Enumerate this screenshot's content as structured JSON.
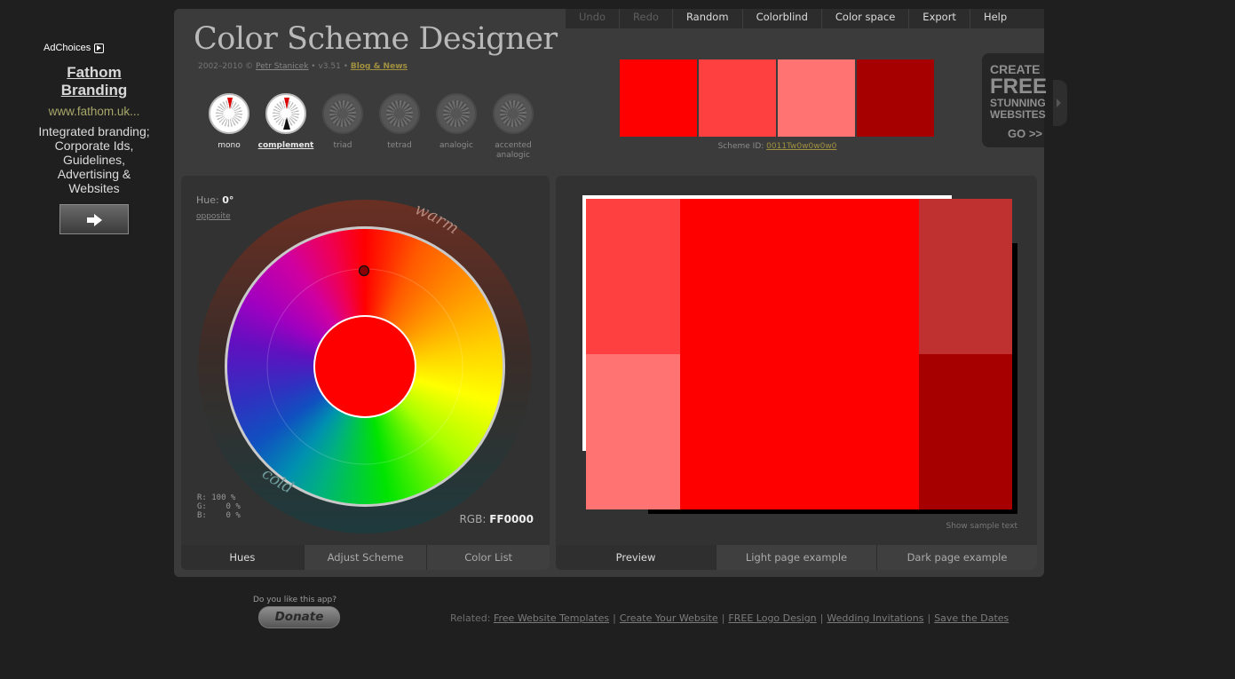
{
  "ad": {
    "adchoices": "AdChoices",
    "title": "Fathom Branding",
    "url": "www.fathom.uk...",
    "description": "Integrated branding; Corporate Ids, Guidelines, Advertising & Websites",
    "button_icon": "arrow-right-icon"
  },
  "header": {
    "title": "Color Scheme Designer",
    "credits_prefix": "2002–2010 © ",
    "author": "Petr Stanicek",
    "version": " • v3.51 • ",
    "blog": "Blog & News"
  },
  "menu": [
    {
      "label": "Undo",
      "enabled": false
    },
    {
      "label": "Redo",
      "enabled": false
    },
    {
      "label": "Random",
      "enabled": true
    },
    {
      "label": "Colorblind",
      "enabled": true
    },
    {
      "label": "Color space",
      "enabled": true
    },
    {
      "label": "Export",
      "enabled": true
    },
    {
      "label": "Help",
      "enabled": true
    }
  ],
  "modes": [
    {
      "label": "mono",
      "active": false,
      "available": true
    },
    {
      "label": "complement",
      "active": true,
      "available": true
    },
    {
      "label": "triad",
      "active": false,
      "available": false
    },
    {
      "label": "tetrad",
      "active": false,
      "available": false
    },
    {
      "label": "analogic",
      "active": false,
      "available": false
    },
    {
      "label": "accented analogic",
      "active": false,
      "available": false
    }
  ],
  "scheme": {
    "swatches": [
      "#FF0000",
      "#FF4040",
      "#FF7373",
      "#A60000"
    ],
    "id_label": "Scheme ID: ",
    "id_value": "0011Tw0w0w0w0"
  },
  "promo": {
    "line1": "CREATE",
    "line2": "FREE",
    "line3": "STUNNING",
    "line4": "WEBSITES",
    "cta": "GO >>"
  },
  "wheel": {
    "hue_label": "Hue: ",
    "hue_value": "0°",
    "opposite": "opposite",
    "warm": "warm",
    "cold": "cold",
    "selected_color": "#FF0000",
    "rgb_pct": "R: 100 %\nG:    0 %\nB:    0 %",
    "rgb_label": "RGB: ",
    "rgb_value": "FF0000",
    "tabs": [
      "Hues",
      "Adjust Scheme",
      "Color List"
    ]
  },
  "preview": {
    "colors": {
      "main": "#FF0000",
      "light1": "#FF4040",
      "light2": "#FF7373",
      "dark1": "#BF3030",
      "dark2": "#A60000"
    },
    "sample_text": "Show sample text",
    "tabs": [
      "Preview",
      "Light page example",
      "Dark page example"
    ]
  },
  "footer": {
    "question": "Do you like this app?",
    "donate": "Donate",
    "related_label": "Related: ",
    "links": [
      "Free Website Templates",
      "Create Your Website",
      "FREE Logo Design",
      "Wedding Invitations",
      "Save the Dates"
    ]
  }
}
